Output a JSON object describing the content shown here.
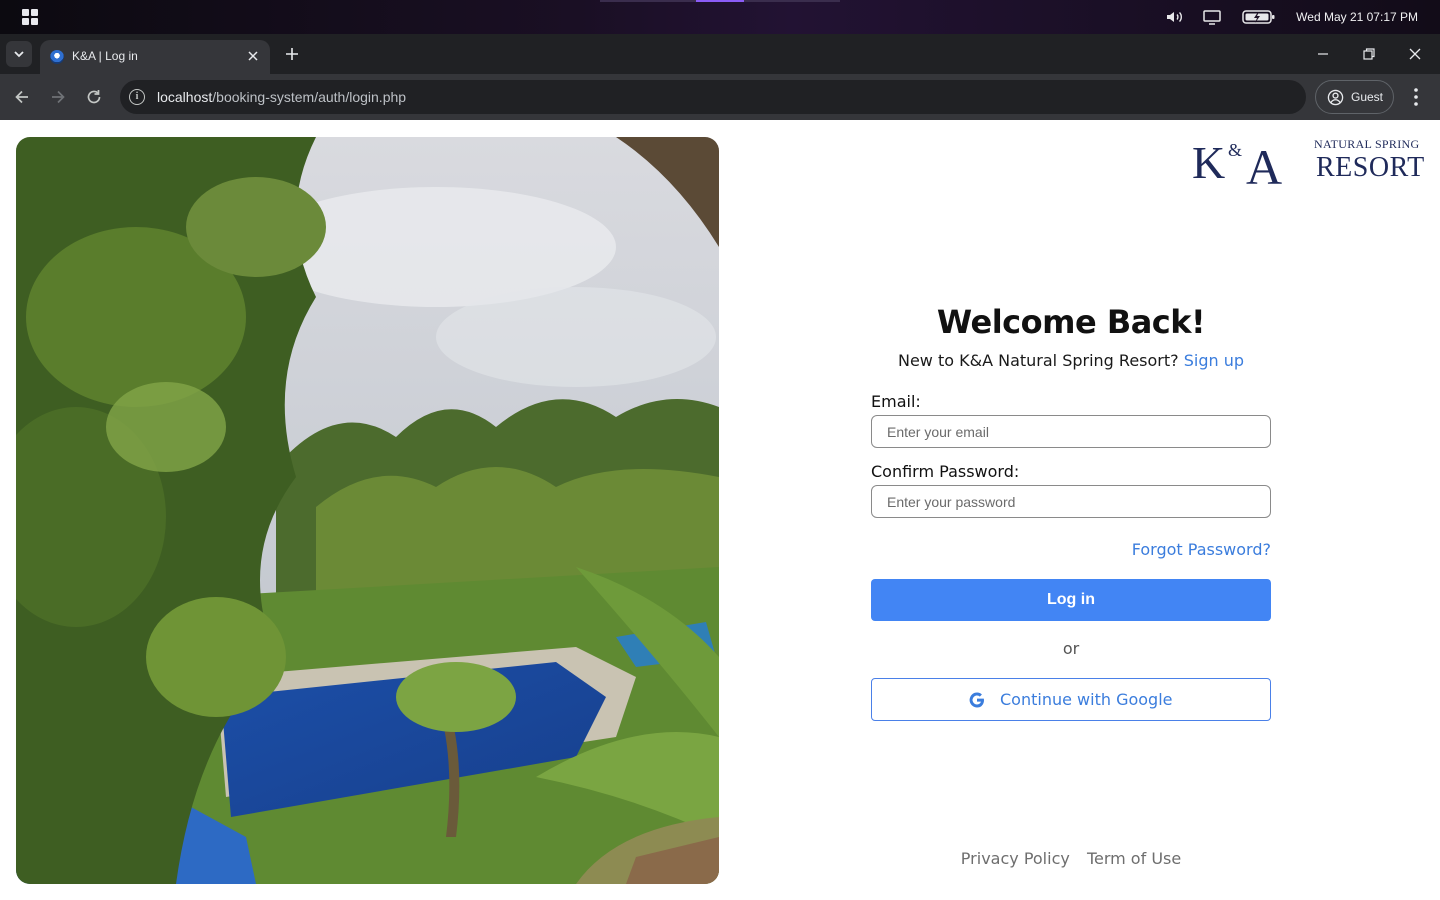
{
  "os": {
    "clock": "Wed May 21  07:17 PM",
    "icons": [
      "windows-logo-icon",
      "volume-icon",
      "display-icon",
      "battery-charging-icon"
    ]
  },
  "browser": {
    "tab_title": "K&A | Log in",
    "url_host": "localhost",
    "url_path": "/booking-system/auth/login.php",
    "profile_label": "Guest"
  },
  "logo": {
    "mark": "K&A",
    "tagline": "NATURAL SPRING",
    "name": "RESORT"
  },
  "login": {
    "heading": "Welcome Back!",
    "signup_prompt": "New to K&A Natural Spring Resort?",
    "signup_link": "Sign up",
    "email_label": "Email:",
    "email_placeholder": "Enter your email",
    "password_label": "Confirm Password:",
    "password_placeholder": "Enter your password",
    "forgot_link": "Forgot Password?",
    "login_button": "Log in",
    "divider": "or",
    "google_button": "Continue with Google"
  },
  "footer": {
    "privacy": "Privacy Policy",
    "terms": "Term of Use"
  },
  "colors": {
    "primary": "#4285f4",
    "link": "#3b7ddd",
    "brand_navy": "#1f2a5a"
  }
}
